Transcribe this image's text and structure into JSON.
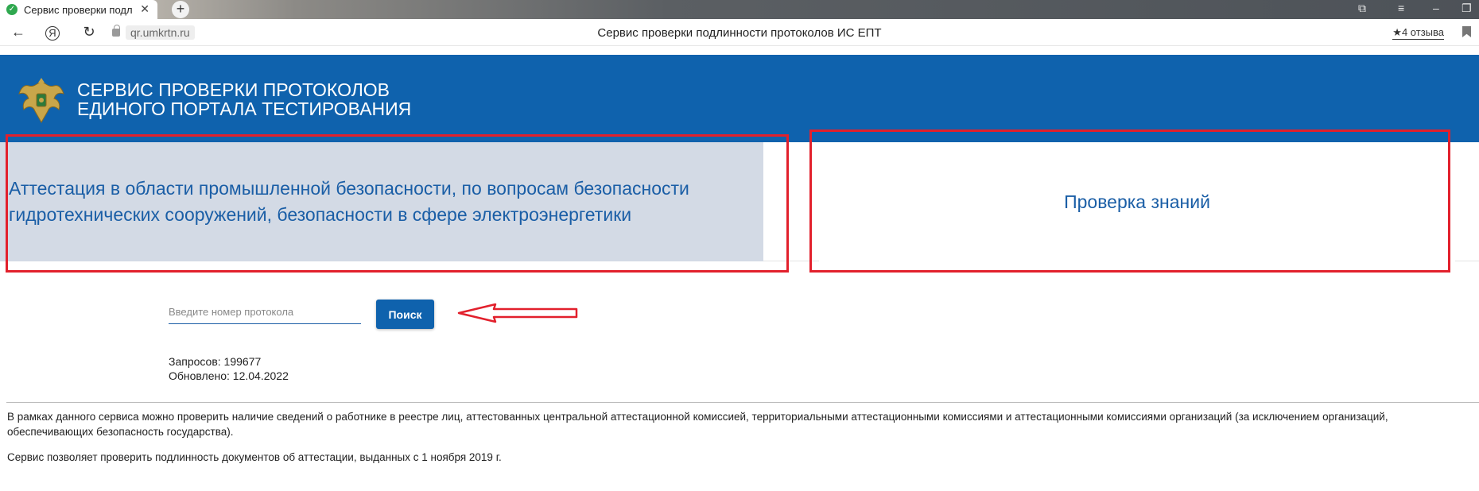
{
  "browser": {
    "tab_title": "Сервис проверки подл",
    "tab_close": "✕",
    "new_tab": "+",
    "url": "qr.umkrtn.ru",
    "page_title": "Сервис проверки подлинности протоколов ИС ЕПТ",
    "reviews": "★4 отзыва",
    "back_icon": "←",
    "yandex_icon": "Я",
    "reload_icon": "↻",
    "window_controls": [
      "⧉",
      "≡",
      "–",
      "❐"
    ]
  },
  "header": {
    "title_line1": "СЕРВИС ПРОВЕРКИ ПРОТОКОЛОВ",
    "title_line2": "ЕДИНОГО ПОРТАЛА ТЕСТИРОВАНИЯ"
  },
  "tabs": {
    "attestation_line1": "Аттестация в области промышленной безопасности, по вопросам безопасности",
    "attestation_line2": "гидротехнических сооружений, безопасности в сфере электроэнергетики",
    "knowledge": "Проверка знаний"
  },
  "search": {
    "placeholder": "Введите номер протокола",
    "value": "",
    "button_label": "Поиск"
  },
  "stats": {
    "requests": "Запросов: 199677",
    "updated": "Обновлено: 12.04.2022"
  },
  "info": {
    "paragraph1": "В рамках данного сервиса можно проверить наличие сведений о работнике в реестре лиц, аттестованных центральной аттестационной комиссией, территориальными аттестационными комиссиями и аттестационными комиссиями организаций (за исключением организаций, обеспечивающих безопасность государства).",
    "paragraph2": "Сервис позволяет проверить подлинность документов об аттестации, выданных с 1 ноября 2019 г."
  },
  "colors": {
    "brand_blue": "#0f62ad",
    "tab_active_bg": "#d3dae5",
    "annotation_red": "#e2202c"
  }
}
